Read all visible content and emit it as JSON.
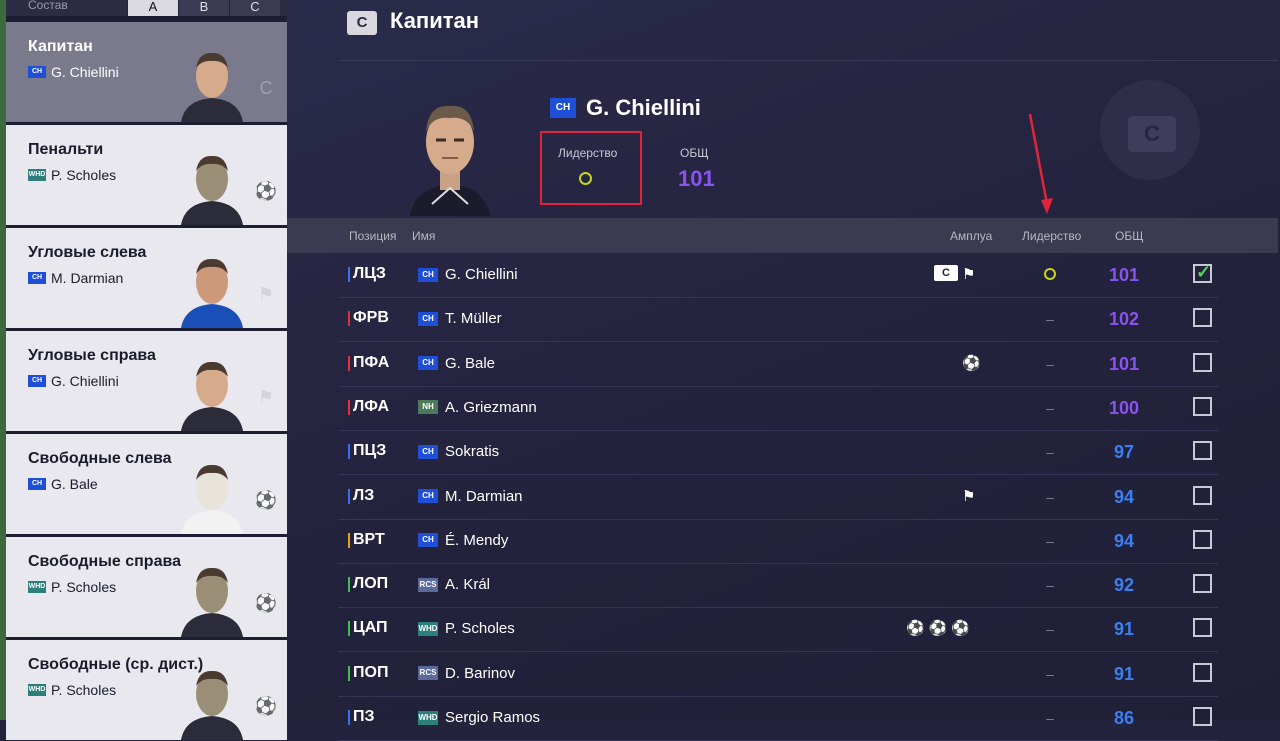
{
  "sidebar": {
    "section_label": "Состав",
    "tabs": [
      "A",
      "B",
      "C"
    ],
    "items": [
      {
        "title": "Капитан",
        "badge": "CH",
        "player": "G. Chiellini",
        "icon": "C"
      },
      {
        "title": "Пенальти",
        "badge": "WHD",
        "player": "P. Scholes",
        "icon": "⚽"
      },
      {
        "title": "Угловые слева",
        "badge": "CH",
        "player": "M. Darmian",
        "icon": "⚑"
      },
      {
        "title": "Угловые справа",
        "badge": "CH",
        "player": "G. Chiellini",
        "icon": "⚑"
      },
      {
        "title": "Свободные слева",
        "badge": "CH",
        "player": "G. Bale",
        "icon": "⚽"
      },
      {
        "title": "Свободные справа",
        "badge": "WHD",
        "player": "P. Scholes",
        "icon": "⚽"
      },
      {
        "title": "Свободные (ср. дист.)",
        "badge": "WHD",
        "player": "P. Scholes",
        "icon": "⚽"
      }
    ]
  },
  "header": {
    "icon": "C",
    "title": "Капитан"
  },
  "detail": {
    "badge": "CH",
    "name": "G. Chiellini",
    "leadership_label": "Лидерство",
    "ovr_label": "ОБЩ",
    "ovr_value": "101"
  },
  "table": {
    "headers": {
      "position": "Позиция",
      "name": "Имя",
      "role": "Амплуа",
      "leadership": "Лидерство",
      "ovr": "ОБЩ"
    },
    "rows": [
      {
        "pos": "ЛЦЗ",
        "pc": "#3a6df0",
        "badge": "CH",
        "name": "G. Chiellini",
        "roles": [
          "C",
          "⚑"
        ],
        "lead": "circle",
        "ovr": "101",
        "ovr_color": "#8b52f2",
        "checked": true
      },
      {
        "pos": "ФРВ",
        "pc": "#e0303c",
        "badge": "CH",
        "name": "T. Müller",
        "roles": [],
        "lead": "–",
        "ovr": "102",
        "ovr_color": "#8b52f2",
        "checked": false
      },
      {
        "pos": "ПФА",
        "pc": "#e0303c",
        "badge": "CH",
        "name": "G. Bale",
        "roles": [
          "⚽"
        ],
        "lead": "–",
        "ovr": "101",
        "ovr_color": "#8b52f2",
        "checked": false
      },
      {
        "pos": "ЛФА",
        "pc": "#e0303c",
        "badge": "NH",
        "name": "A. Griezmann",
        "roles": [],
        "lead": "–",
        "ovr": "100",
        "ovr_color": "#8b52f2",
        "checked": false
      },
      {
        "pos": "ПЦЗ",
        "pc": "#3a6df0",
        "badge": "CH",
        "name": "Sokratis",
        "roles": [],
        "lead": "–",
        "ovr": "97",
        "ovr_color": "#3b7ff0",
        "checked": false
      },
      {
        "pos": "ЛЗ",
        "pc": "#3a6df0",
        "badge": "CH",
        "name": "M. Darmian",
        "roles": [
          "⚑"
        ],
        "lead": "–",
        "ovr": "94",
        "ovr_color": "#3b7ff0",
        "checked": false
      },
      {
        "pos": "ВРТ",
        "pc": "#e6a318",
        "badge": "CH",
        "name": "É. Mendy",
        "roles": [],
        "lead": "–",
        "ovr": "94",
        "ovr_color": "#3b7ff0",
        "checked": false
      },
      {
        "pos": "ЛОП",
        "pc": "#3fbf4a",
        "badge": "RCS",
        "name": "A. Král",
        "roles": [],
        "lead": "–",
        "ovr": "92",
        "ovr_color": "#3b7ff0",
        "checked": false
      },
      {
        "pos": "ЦАП",
        "pc": "#3fbf4a",
        "badge": "WHD",
        "name": "P. Scholes",
        "roles": [
          "⚽",
          "⚽",
          "⚽"
        ],
        "lead": "–",
        "ovr": "91",
        "ovr_color": "#3b7ff0",
        "checked": false
      },
      {
        "pos": "ПОП",
        "pc": "#3fbf4a",
        "badge": "RCS",
        "name": "D. Barinov",
        "roles": [],
        "lead": "–",
        "ovr": "91",
        "ovr_color": "#3b7ff0",
        "checked": false
      },
      {
        "pos": "ПЗ",
        "pc": "#3a6df0",
        "badge": "WHD",
        "name": "Sergio Ramos",
        "roles": [],
        "lead": "–",
        "ovr": "86",
        "ovr_color": "#3b7ff0",
        "checked": false
      }
    ]
  }
}
